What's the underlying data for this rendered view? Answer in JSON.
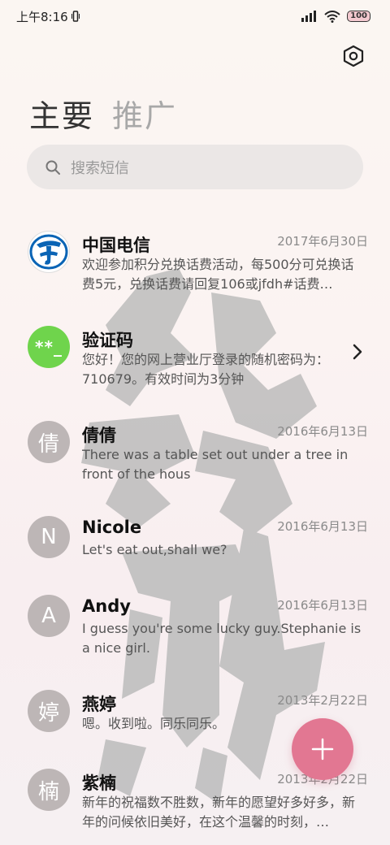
{
  "status_bar": {
    "time": "上午8:16",
    "battery": "100"
  },
  "header": {
    "tab_main": "主要",
    "tab_promo": "推广"
  },
  "search": {
    "placeholder": "搜索短信"
  },
  "conversations": [
    {
      "name": "中国电信",
      "date": "2017年6月30日",
      "preview": "欢迎参加积分兑换话费活动，每500分可兑换话费5元，兑换话费请回复106或jfdh#话费…",
      "avatar": ""
    },
    {
      "name": "验证码",
      "date": "",
      "preview": "您好！您的网上营业厅登录的随机密码为：710679。有效时间为3分钟",
      "avatar": "**_"
    },
    {
      "name": "倩倩",
      "date": "2016年6月13日",
      "preview": "There was a table set out under a tree in front of the hous",
      "avatar": "倩"
    },
    {
      "name": "Nicole",
      "date": "2016年6月13日",
      "preview": "Let's eat out,shall we?",
      "avatar": "N"
    },
    {
      "name": "Andy",
      "date": "2016年6月13日",
      "preview": "I guess you're some lucky guy.Stephanie is a nice girl.",
      "avatar": "A"
    },
    {
      "name": "燕婷",
      "date": "2013年2月22日",
      "preview": "嗯。收到啦。同乐同乐。",
      "avatar": "婷"
    },
    {
      "name": "紫楠",
      "date": "2013年2月22日",
      "preview": "新年的祝福数不胜数，新年的愿望好多好多，新年的问候依旧美好，在这个温馨的时刻，…",
      "avatar": "楠"
    }
  ],
  "colors": {
    "fab": "#e27792",
    "verify_avatar": "#6fd44c",
    "avatar_default": "#bdb6b6"
  },
  "icons": {
    "settings": "hexagon-gear-icon",
    "search": "search-icon",
    "fab": "plus-icon",
    "chevron": "chevron-right-icon"
  }
}
